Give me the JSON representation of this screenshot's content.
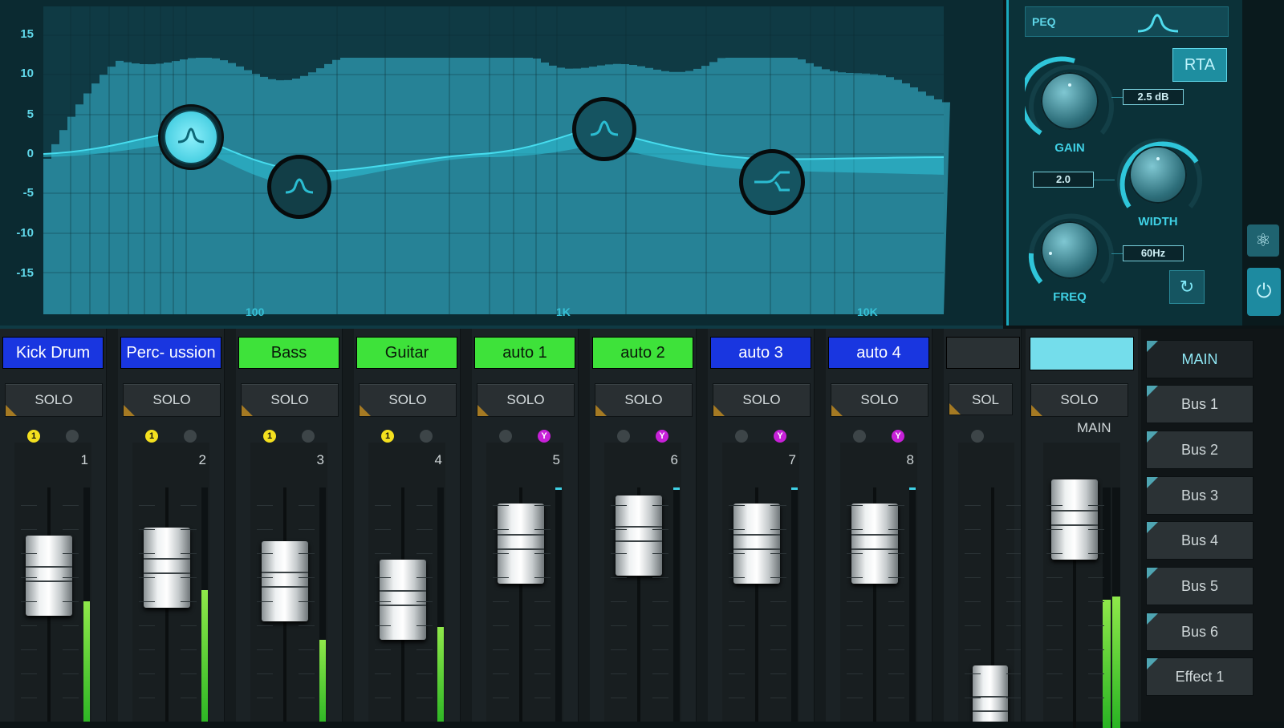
{
  "eq": {
    "y_ticks": [
      "15",
      "10",
      "5",
      "0",
      "-5",
      "-10",
      "-15"
    ],
    "x_ticks": [
      "100",
      "1K",
      "10K"
    ],
    "nodes": [
      {
        "name": "eq-band-1-handle",
        "type": "peak",
        "selected": true
      },
      {
        "name": "eq-band-2-handle",
        "type": "peak",
        "selected": false
      },
      {
        "name": "eq-band-3-handle",
        "type": "peak",
        "selected": false
      },
      {
        "name": "eq-band-4-handle",
        "type": "shelf",
        "selected": false
      }
    ]
  },
  "peq": {
    "title": "PEQ",
    "rta_label": "RTA",
    "gain": {
      "label": "GAIN",
      "value": "2.5 dB"
    },
    "width": {
      "label": "WIDTH",
      "value": "2.0"
    },
    "freq": {
      "label": "FREQ",
      "value": "60Hz"
    },
    "reset_icon": "reset-icon",
    "power_icon": "power-icon"
  },
  "channels": [
    {
      "name": "Kick Drum",
      "solo": "SOLO",
      "num": "1",
      "color": "#1936e0",
      "text_color": "#ffffff",
      "led_left": "1",
      "led_left_color": "yellow",
      "led_right": "",
      "led_right_color": "off"
    },
    {
      "name": "Perc- ussion",
      "solo": "SOLO",
      "num": "2",
      "color": "#1936e0",
      "text_color": "#ffffff",
      "led_left": "1",
      "led_left_color": "yellow",
      "led_right": "",
      "led_right_color": "off"
    },
    {
      "name": "Bass",
      "solo": "SOLO",
      "num": "3",
      "color": "#3ee23a",
      "text_color": "#0a1a0a",
      "led_left": "1",
      "led_left_color": "yellow",
      "led_right": "",
      "led_right_color": "off"
    },
    {
      "name": "Guitar",
      "solo": "SOLO",
      "num": "4",
      "color": "#3ee23a",
      "text_color": "#0a1a0a",
      "led_left": "1",
      "led_left_color": "yellow",
      "led_right": "",
      "led_right_color": "off"
    },
    {
      "name": "auto 1",
      "solo": "SOLO",
      "num": "5",
      "color": "#3ee23a",
      "text_color": "#0a1a0a",
      "led_left": "",
      "led_left_color": "off",
      "led_right": "Y",
      "led_right_color": "magenta"
    },
    {
      "name": "auto 2",
      "solo": "SOLO",
      "num": "6",
      "color": "#3ee23a",
      "text_color": "#0a1a0a",
      "led_left": "",
      "led_left_color": "off",
      "led_right": "Y",
      "led_right_color": "magenta"
    },
    {
      "name": "auto 3",
      "solo": "SOLO",
      "num": "7",
      "color": "#1936e0",
      "text_color": "#ffffff",
      "led_left": "",
      "led_left_color": "off",
      "led_right": "Y",
      "led_right_color": "magenta"
    },
    {
      "name": "auto 4",
      "solo": "SOLO",
      "num": "8",
      "color": "#1936e0",
      "text_color": "#ffffff",
      "led_left": "",
      "led_left_color": "off",
      "led_right": "Y",
      "led_right_color": "magenta"
    }
  ],
  "partial_channel": {
    "solo": "SOL"
  },
  "main": {
    "solo": "SOLO",
    "label": "MAIN",
    "color": "#74ddeb"
  },
  "buses": [
    "MAIN",
    "Bus 1",
    "Bus 2",
    "Bus 3",
    "Bus 4",
    "Bus 5",
    "Bus 6",
    "Effect 1"
  ],
  "colors": {
    "accent": "#3fd0e4",
    "eq_fill": "#2a8fa4",
    "solo_corner": "#a57a23"
  }
}
